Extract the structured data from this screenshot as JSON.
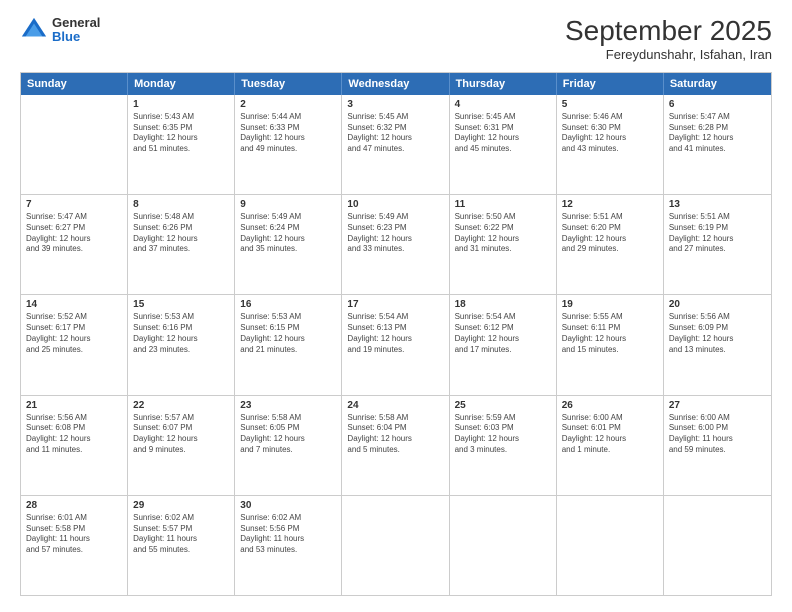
{
  "logo": {
    "general": "General",
    "blue": "Blue"
  },
  "header": {
    "month": "September 2025",
    "location": "Fereydunshahr, Isfahan, Iran"
  },
  "days": [
    "Sunday",
    "Monday",
    "Tuesday",
    "Wednesday",
    "Thursday",
    "Friday",
    "Saturday"
  ],
  "weeks": [
    [
      {
        "day": "",
        "info": ""
      },
      {
        "day": "1",
        "info": "Sunrise: 5:43 AM\nSunset: 6:35 PM\nDaylight: 12 hours\nand 51 minutes."
      },
      {
        "day": "2",
        "info": "Sunrise: 5:44 AM\nSunset: 6:33 PM\nDaylight: 12 hours\nand 49 minutes."
      },
      {
        "day": "3",
        "info": "Sunrise: 5:45 AM\nSunset: 6:32 PM\nDaylight: 12 hours\nand 47 minutes."
      },
      {
        "day": "4",
        "info": "Sunrise: 5:45 AM\nSunset: 6:31 PM\nDaylight: 12 hours\nand 45 minutes."
      },
      {
        "day": "5",
        "info": "Sunrise: 5:46 AM\nSunset: 6:30 PM\nDaylight: 12 hours\nand 43 minutes."
      },
      {
        "day": "6",
        "info": "Sunrise: 5:47 AM\nSunset: 6:28 PM\nDaylight: 12 hours\nand 41 minutes."
      }
    ],
    [
      {
        "day": "7",
        "info": "Sunrise: 5:47 AM\nSunset: 6:27 PM\nDaylight: 12 hours\nand 39 minutes."
      },
      {
        "day": "8",
        "info": "Sunrise: 5:48 AM\nSunset: 6:26 PM\nDaylight: 12 hours\nand 37 minutes."
      },
      {
        "day": "9",
        "info": "Sunrise: 5:49 AM\nSunset: 6:24 PM\nDaylight: 12 hours\nand 35 minutes."
      },
      {
        "day": "10",
        "info": "Sunrise: 5:49 AM\nSunset: 6:23 PM\nDaylight: 12 hours\nand 33 minutes."
      },
      {
        "day": "11",
        "info": "Sunrise: 5:50 AM\nSunset: 6:22 PM\nDaylight: 12 hours\nand 31 minutes."
      },
      {
        "day": "12",
        "info": "Sunrise: 5:51 AM\nSunset: 6:20 PM\nDaylight: 12 hours\nand 29 minutes."
      },
      {
        "day": "13",
        "info": "Sunrise: 5:51 AM\nSunset: 6:19 PM\nDaylight: 12 hours\nand 27 minutes."
      }
    ],
    [
      {
        "day": "14",
        "info": "Sunrise: 5:52 AM\nSunset: 6:17 PM\nDaylight: 12 hours\nand 25 minutes."
      },
      {
        "day": "15",
        "info": "Sunrise: 5:53 AM\nSunset: 6:16 PM\nDaylight: 12 hours\nand 23 minutes."
      },
      {
        "day": "16",
        "info": "Sunrise: 5:53 AM\nSunset: 6:15 PM\nDaylight: 12 hours\nand 21 minutes."
      },
      {
        "day": "17",
        "info": "Sunrise: 5:54 AM\nSunset: 6:13 PM\nDaylight: 12 hours\nand 19 minutes."
      },
      {
        "day": "18",
        "info": "Sunrise: 5:54 AM\nSunset: 6:12 PM\nDaylight: 12 hours\nand 17 minutes."
      },
      {
        "day": "19",
        "info": "Sunrise: 5:55 AM\nSunset: 6:11 PM\nDaylight: 12 hours\nand 15 minutes."
      },
      {
        "day": "20",
        "info": "Sunrise: 5:56 AM\nSunset: 6:09 PM\nDaylight: 12 hours\nand 13 minutes."
      }
    ],
    [
      {
        "day": "21",
        "info": "Sunrise: 5:56 AM\nSunset: 6:08 PM\nDaylight: 12 hours\nand 11 minutes."
      },
      {
        "day": "22",
        "info": "Sunrise: 5:57 AM\nSunset: 6:07 PM\nDaylight: 12 hours\nand 9 minutes."
      },
      {
        "day": "23",
        "info": "Sunrise: 5:58 AM\nSunset: 6:05 PM\nDaylight: 12 hours\nand 7 minutes."
      },
      {
        "day": "24",
        "info": "Sunrise: 5:58 AM\nSunset: 6:04 PM\nDaylight: 12 hours\nand 5 minutes."
      },
      {
        "day": "25",
        "info": "Sunrise: 5:59 AM\nSunset: 6:03 PM\nDaylight: 12 hours\nand 3 minutes."
      },
      {
        "day": "26",
        "info": "Sunrise: 6:00 AM\nSunset: 6:01 PM\nDaylight: 12 hours\nand 1 minute."
      },
      {
        "day": "27",
        "info": "Sunrise: 6:00 AM\nSunset: 6:00 PM\nDaylight: 11 hours\nand 59 minutes."
      }
    ],
    [
      {
        "day": "28",
        "info": "Sunrise: 6:01 AM\nSunset: 5:58 PM\nDaylight: 11 hours\nand 57 minutes."
      },
      {
        "day": "29",
        "info": "Sunrise: 6:02 AM\nSunset: 5:57 PM\nDaylight: 11 hours\nand 55 minutes."
      },
      {
        "day": "30",
        "info": "Sunrise: 6:02 AM\nSunset: 5:56 PM\nDaylight: 11 hours\nand 53 minutes."
      },
      {
        "day": "",
        "info": ""
      },
      {
        "day": "",
        "info": ""
      },
      {
        "day": "",
        "info": ""
      },
      {
        "day": "",
        "info": ""
      }
    ]
  ]
}
